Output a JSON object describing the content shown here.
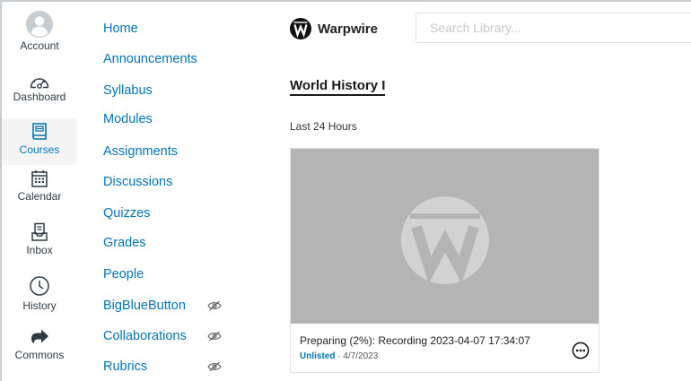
{
  "global_nav": {
    "items": [
      {
        "label": "Account",
        "icon": "account-icon"
      },
      {
        "label": "Dashboard",
        "icon": "dashboard-icon"
      },
      {
        "label": "Courses",
        "icon": "courses-icon",
        "active": true
      },
      {
        "label": "Calendar",
        "icon": "calendar-icon"
      },
      {
        "label": "Inbox",
        "icon": "inbox-icon"
      },
      {
        "label": "History",
        "icon": "history-icon"
      },
      {
        "label": "Commons",
        "icon": "commons-icon"
      }
    ]
  },
  "course_nav": {
    "items": [
      {
        "label": "Home"
      },
      {
        "label": "Announcements"
      },
      {
        "label": "Syllabus"
      },
      {
        "label": "Modules"
      },
      {
        "label": "Assignments"
      },
      {
        "label": "Discussions"
      },
      {
        "label": "Quizzes"
      },
      {
        "label": "Grades"
      },
      {
        "label": "People"
      },
      {
        "label": "BigBlueButton",
        "hidden_from_students": true
      },
      {
        "label": "Collaborations",
        "hidden_from_students": true
      },
      {
        "label": "Rubrics",
        "hidden_from_students": true
      }
    ]
  },
  "app": {
    "brand": "Warpwire",
    "search_placeholder": "Search Library...",
    "library_title": "World History I",
    "filter_label": "Last 24 Hours"
  },
  "media": [
    {
      "title": "Preparing (2%): Recording 2023-04-07 17:34:07",
      "status": "Unlisted",
      "separator": " · ",
      "date": "4/7/2023",
      "progress_percent": 2
    }
  ],
  "colors": {
    "link": "#0374b5",
    "active_nav_bg": "#f5f5f5",
    "thumbnail_bg": "#b4b4b4"
  }
}
